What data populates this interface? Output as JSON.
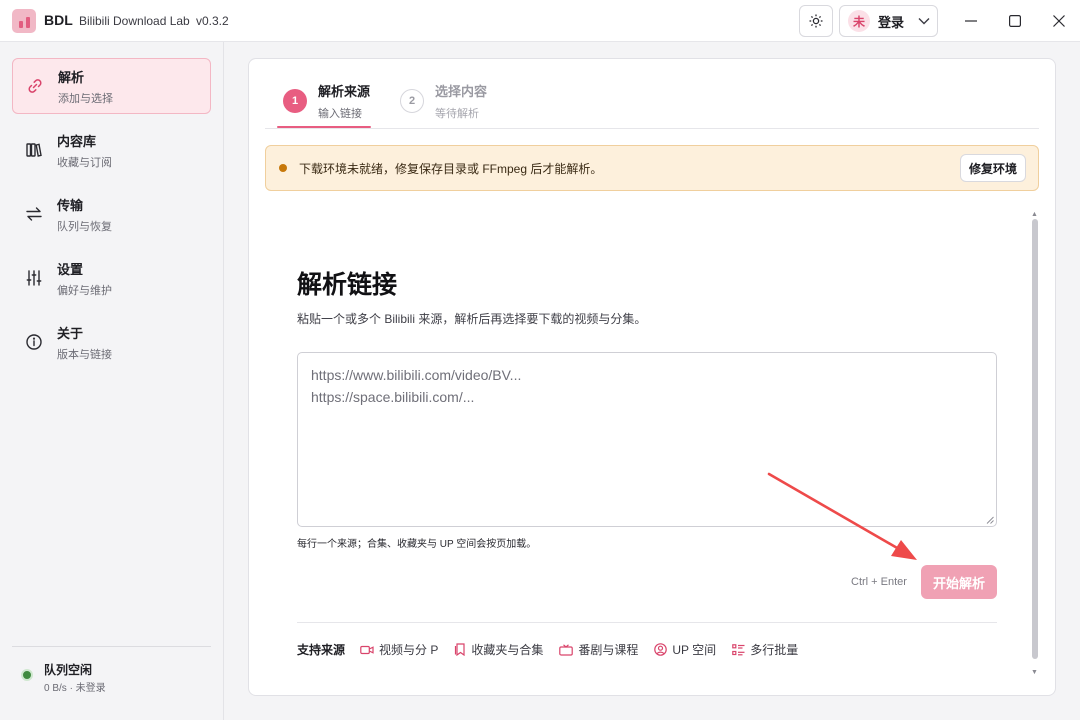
{
  "app": {
    "short_name": "BDL",
    "full_name": "Bilibili Download Lab",
    "version": "v0.3.2"
  },
  "header": {
    "avatar_text": "未",
    "login_label": "登录",
    "theme_icon": "sun-icon"
  },
  "sidebar": {
    "items": [
      {
        "title": "解析",
        "subtitle": "添加与选择",
        "icon": "link-icon"
      },
      {
        "title": "内容库",
        "subtitle": "收藏与订阅",
        "icon": "library-icon"
      },
      {
        "title": "传输",
        "subtitle": "队列与恢复",
        "icon": "transfer-icon"
      },
      {
        "title": "设置",
        "subtitle": "偏好与维护",
        "icon": "sliders-icon"
      },
      {
        "title": "关于",
        "subtitle": "版本与链接",
        "icon": "info-icon"
      }
    ],
    "status": {
      "title": "队列空闲",
      "subtitle": "0 B/s · 未登录"
    }
  },
  "steps": [
    {
      "number": "1",
      "title": "解析来源",
      "subtitle": "输入链接"
    },
    {
      "number": "2",
      "title": "选择内容",
      "subtitle": "等待解析"
    }
  ],
  "alert": {
    "text": "下载环境未就绪，修复保存目录或 FFmpeg 后才能解析。",
    "button": "修复环境"
  },
  "parse": {
    "heading": "解析链接",
    "description": "粘贴一个或多个 Bilibili 来源，解析后再选择要下载的视频与分集。",
    "placeholder_lines": [
      "https://www.bilibili.com/video/BV...",
      "https://space.bilibili.com/..."
    ],
    "hint": "每行一个来源；合集、收藏夹与 UP 空间会按页加载。",
    "shortcut": "Ctrl + Enter",
    "start_button": "开始解析"
  },
  "sources": {
    "label": "支持来源",
    "items": [
      {
        "label": "视频与分 P",
        "icon": "video-icon"
      },
      {
        "label": "收藏夹与合集",
        "icon": "bookmark-icon"
      },
      {
        "label": "番剧与课程",
        "icon": "tv-icon"
      },
      {
        "label": "UP 空间",
        "icon": "user-icon"
      },
      {
        "label": "多行批量",
        "icon": "list-icon"
      }
    ]
  },
  "colors": {
    "accent": "#e85d81",
    "accent_light": "#f0a1b4",
    "warning_bg": "#fdf0dc",
    "status_ok": "#3f8a3f"
  }
}
